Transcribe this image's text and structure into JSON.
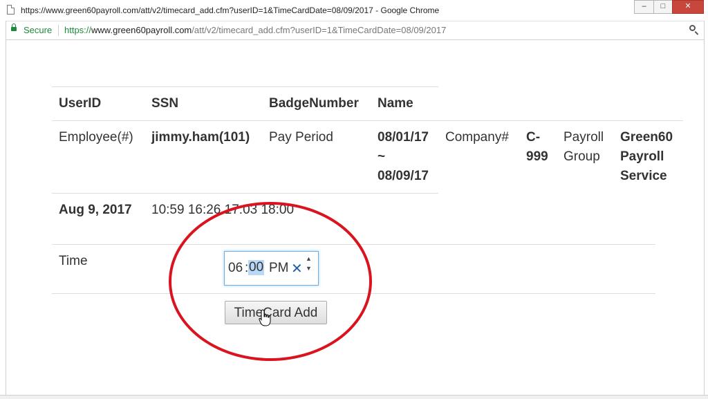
{
  "window": {
    "title": "https://www.green60payroll.com/att/v2/timecard_add.cfm?userID=1&TimeCardDate=08/09/2017 - Google Chrome",
    "buttons": {
      "minimize": "–",
      "maximize": "□",
      "close": "✕"
    }
  },
  "addressbar": {
    "secure_label": "Secure",
    "url_scheme": "https://",
    "url_host": "www.green60payroll.com",
    "url_path": "/att/v2/timecard_add.cfm?userID=1&TimeCardDate=08/09/2017"
  },
  "header_row": {
    "userid": "UserID",
    "ssn": "SSN",
    "badge": "BadgeNumber",
    "name": "Name"
  },
  "info_row": {
    "employee_label": "Employee(#)",
    "employee_value": "jimmy.ham(101)",
    "pay_period_label": "Pay Period",
    "pay_period_start": "08/01/17",
    "pay_period_tilde": "~",
    "pay_period_end": "08/09/17",
    "company_label": "Company#",
    "company_value_1": "C-",
    "company_value_2": "999",
    "payroll_group_label_1": "Payroll",
    "payroll_group_label_2": "Group",
    "payroll_group_value_1": "Green60",
    "payroll_group_value_2": "Payroll",
    "payroll_group_value_3": "Service"
  },
  "punch_row": {
    "date": "Aug 9, 2017",
    "punches": "10:59 16:26 17:03 18:00"
  },
  "time_row": {
    "label": "Time",
    "hour": "06",
    "separator": ":",
    "minute": "00",
    "ampm": "PM",
    "clear_icon": "✕",
    "spin_up": "▲",
    "spin_down": "▼"
  },
  "submit": {
    "label": "TimeCard Add"
  },
  "colors": {
    "annotation": "#d9141e",
    "secure_green": "#1e8a3c",
    "focus_blue": "#66afe9"
  }
}
